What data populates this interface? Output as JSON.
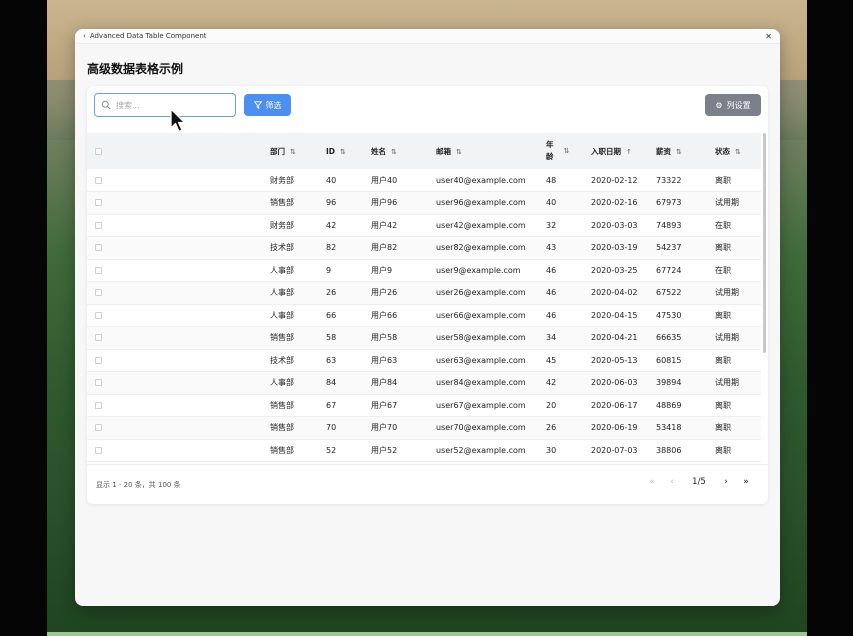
{
  "window": {
    "title": "Advanced Data Table Component"
  },
  "page": {
    "heading": "高级数据表格示例"
  },
  "toolbar": {
    "search_placeholder": "搜索...",
    "filter_label": "筛选",
    "settings_label": "列设置"
  },
  "table": {
    "columns": [
      "部门",
      "ID",
      "姓名",
      "邮箱",
      "年龄",
      "入职日期",
      "薪资",
      "状态"
    ],
    "age_header_top": "年",
    "age_header_bottom": "龄",
    "sort_asc_column": "入职日期",
    "rows": [
      {
        "dept": "财务部",
        "id": "40",
        "name": "用户40",
        "email": "user40@example.com",
        "age": "48",
        "date": "2020-02-12",
        "salary": "73322",
        "status": "离职"
      },
      {
        "dept": "销售部",
        "id": "96",
        "name": "用户96",
        "email": "user96@example.com",
        "age": "40",
        "date": "2020-02-16",
        "salary": "67973",
        "status": "试用期"
      },
      {
        "dept": "财务部",
        "id": "42",
        "name": "用户42",
        "email": "user42@example.com",
        "age": "32",
        "date": "2020-03-03",
        "salary": "74893",
        "status": "在职"
      },
      {
        "dept": "技术部",
        "id": "82",
        "name": "用户82",
        "email": "user82@example.com",
        "age": "43",
        "date": "2020-03-19",
        "salary": "54237",
        "status": "离职"
      },
      {
        "dept": "人事部",
        "id": "9",
        "name": "用户9",
        "email": "user9@example.com",
        "age": "46",
        "date": "2020-03-25",
        "salary": "67724",
        "status": "在职"
      },
      {
        "dept": "人事部",
        "id": "26",
        "name": "用户26",
        "email": "user26@example.com",
        "age": "46",
        "date": "2020-04-02",
        "salary": "67522",
        "status": "试用期"
      },
      {
        "dept": "人事部",
        "id": "66",
        "name": "用户66",
        "email": "user66@example.com",
        "age": "46",
        "date": "2020-04-15",
        "salary": "47530",
        "status": "离职"
      },
      {
        "dept": "销售部",
        "id": "58",
        "name": "用户58",
        "email": "user58@example.com",
        "age": "34",
        "date": "2020-04-21",
        "salary": "66635",
        "status": "试用期"
      },
      {
        "dept": "技术部",
        "id": "63",
        "name": "用户63",
        "email": "user63@example.com",
        "age": "45",
        "date": "2020-05-13",
        "salary": "60815",
        "status": "离职"
      },
      {
        "dept": "人事部",
        "id": "84",
        "name": "用户84",
        "email": "user84@example.com",
        "age": "42",
        "date": "2020-06-03",
        "salary": "39894",
        "status": "试用期"
      },
      {
        "dept": "销售部",
        "id": "67",
        "name": "用户67",
        "email": "user67@example.com",
        "age": "20",
        "date": "2020-06-17",
        "salary": "48869",
        "status": "离职"
      },
      {
        "dept": "销售部",
        "id": "70",
        "name": "用户70",
        "email": "user70@example.com",
        "age": "26",
        "date": "2020-06-19",
        "salary": "53418",
        "status": "离职"
      },
      {
        "dept": "销售部",
        "id": "52",
        "name": "用户52",
        "email": "user52@example.com",
        "age": "30",
        "date": "2020-07-03",
        "salary": "38806",
        "status": "离职"
      }
    ]
  },
  "footer": {
    "info": "显示 1 - 20 条，共 100 条",
    "page_indicator": "1/5"
  },
  "colors": {
    "accent": "#4b8ff0",
    "settings_button": "#7b808a",
    "search_border": "#6a9ef2"
  },
  "icons": [
    "back-chevron-icon",
    "close-icon",
    "search-icon",
    "filter-icon",
    "gear-icon",
    "sort-icon",
    "sort-asc-icon",
    "first-page-icon",
    "prev-page-icon",
    "next-page-icon",
    "last-page-icon",
    "mouse-cursor-icon"
  ]
}
